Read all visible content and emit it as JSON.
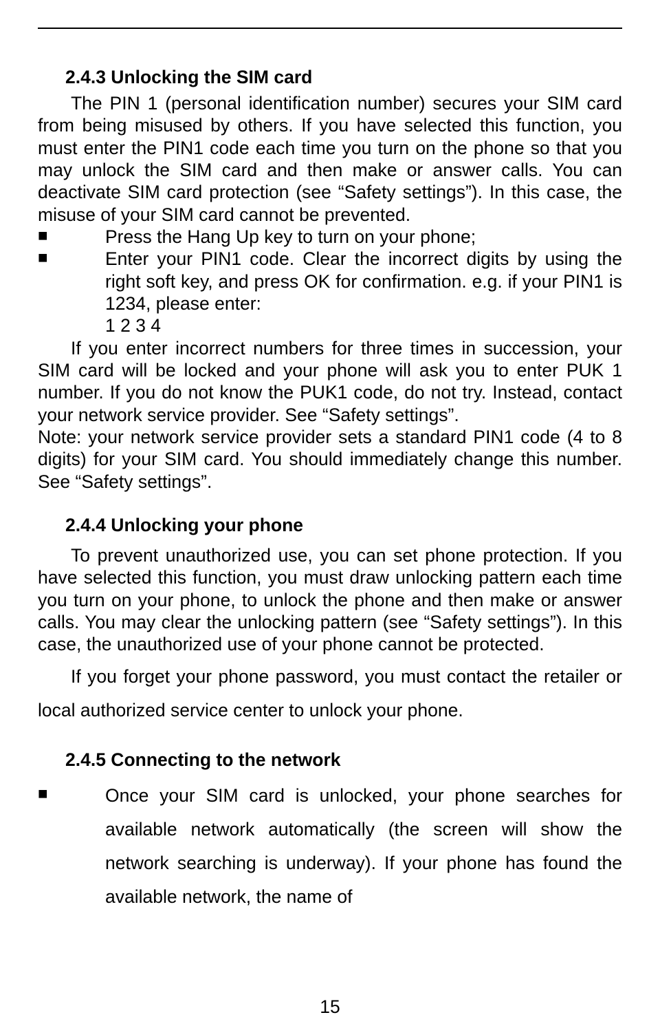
{
  "s243": {
    "heading": "2.4.3 Unlocking the SIM card",
    "p1": "The PIN 1 (personal identification number) secures your SIM card from being misused by others. If you have selected this function, you must enter the PIN1 code each time you turn on the phone so that you may unlock the SIM card and then make or answer calls. You can deactivate SIM card protection (see “Safety settings”). In this case, the misuse of your SIM card cannot be prevented.",
    "b1": "Press the Hang Up key to turn on your phone;",
    "b2": "Enter your PIN1 code. Clear the incorrect digits by using the right soft key, and press OK for confirmation. e.g. if your PIN1 is 1234, please enter:",
    "b2ex": "1 2 3 4",
    "p2": "If you enter incorrect numbers for three times in succession, your SIM card will be locked and your phone will ask you to enter PUK 1 number. If you do not know the PUK1 code, do not try. Instead, contact your network service provider. See “Safety settings”.",
    "note": "Note: your network service provider sets a standard PIN1 code (4 to 8 digits) for your SIM card. You should immediately change this number. See “Safety settings”."
  },
  "s244": {
    "heading": "2.4.4 Unlocking your phone",
    "p1": "To prevent unauthorized use, you can set phone protection. If you have selected this function, you must draw unlocking pattern each time you turn on your phone, to unlock the phone and then make or answer calls. You may clear the unlocking pattern (see “Safety settings”). In this case, the unauthorized use of your phone cannot be protected.",
    "p2": "If you forget your phone password, you must contact the retailer or local authorized service center to unlock your phone."
  },
  "s245": {
    "heading": "2.4.5 Connecting to the network",
    "b1": "Once your SIM card is unlocked, your phone searches for available network automatically (the screen will show the network searching is underway). If your phone has found the available network, the name of"
  },
  "pageNumber": "15"
}
